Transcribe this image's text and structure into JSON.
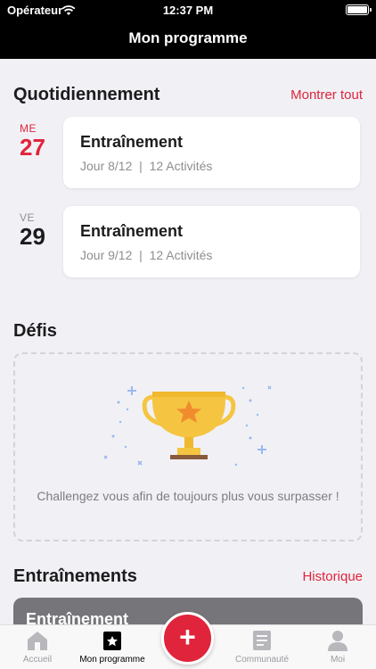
{
  "status_bar": {
    "carrier": "Opérateur",
    "time": "12:37 PM"
  },
  "nav": {
    "title": "Mon programme"
  },
  "daily": {
    "title": "Quotidiennement",
    "link": "Montrer tout",
    "days": [
      {
        "dow": "ME",
        "num": "27",
        "today": true,
        "title": "Entraînement",
        "subtitle": "Jour 8/12  |  12 Activités"
      },
      {
        "dow": "VE",
        "num": "29",
        "today": false,
        "title": "Entraînement",
        "subtitle": "Jour 9/12  |  12 Activités"
      }
    ]
  },
  "challenges": {
    "title": "Défis",
    "message": "Challengez vous afin de toujours plus vous surpasser !"
  },
  "workouts": {
    "title": "Entraînements",
    "link": "Historique",
    "card_title": "Entraînement"
  },
  "tab_bar": {
    "items": [
      {
        "label": "Accueil",
        "icon": "home-icon"
      },
      {
        "label": "Mon programme",
        "icon": "star-calendar-icon",
        "active": true
      },
      {
        "label": "",
        "icon": "plus-icon"
      },
      {
        "label": "Communauté",
        "icon": "newspaper-icon"
      },
      {
        "label": "Moi",
        "icon": "person-icon"
      }
    ],
    "add_symbol": "+"
  },
  "colors": {
    "accent": "#e0243c",
    "trophy": "#f5c542",
    "sparkle": "#9bb8ef"
  }
}
